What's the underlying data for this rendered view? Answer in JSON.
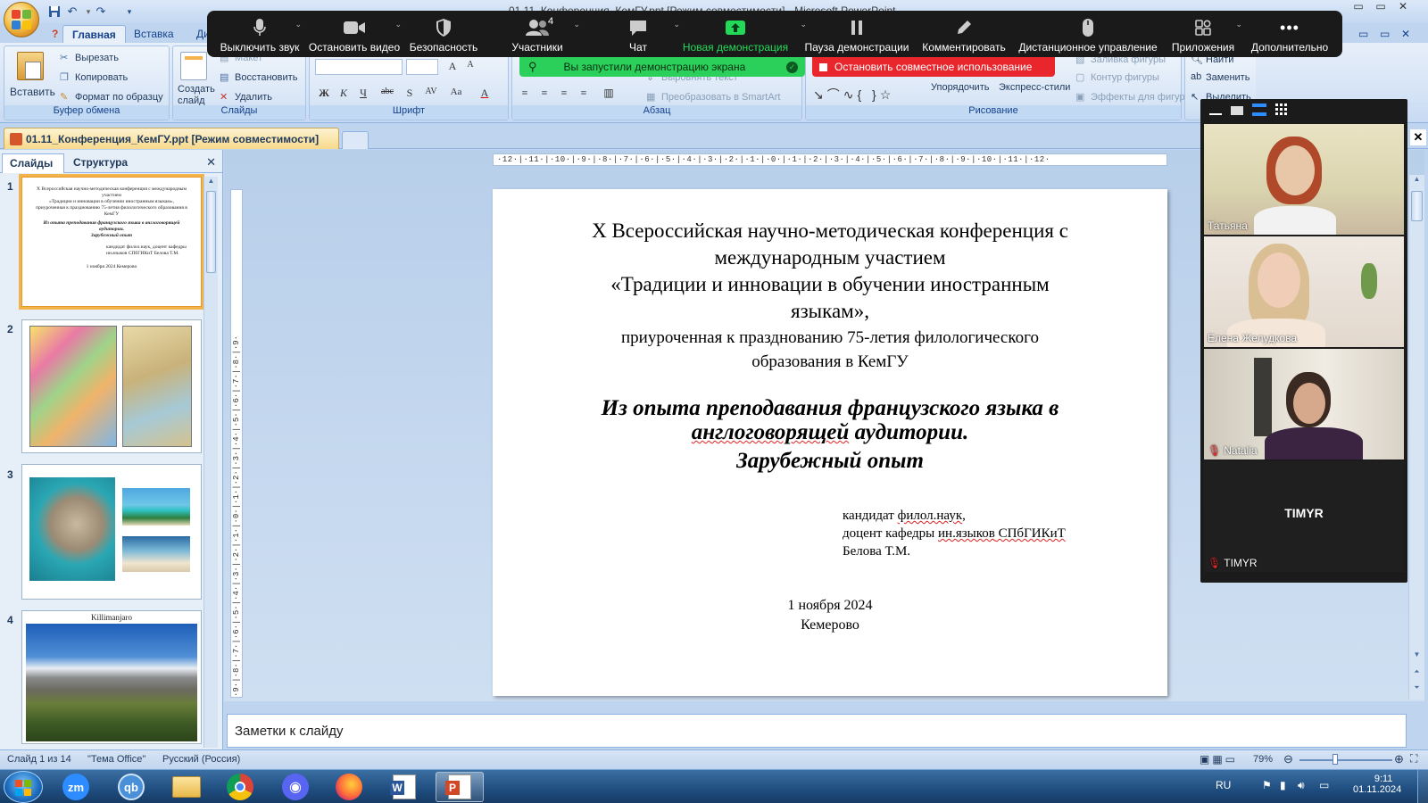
{
  "window": {
    "title": "01.11_Конференция_КемГУ.ppt [Режим совместимости] - Microsoft PowerPoint",
    "minimize": "▭",
    "restore": "▭",
    "close": "✕"
  },
  "ribbon_tabs": [
    "Главная",
    "Вставка",
    "Дизайн"
  ],
  "clipboard": {
    "paste": "Вставить",
    "cut": "Вырезать",
    "copy": "Копировать",
    "format_painter": "Формат по образцу",
    "label": "Буфер обмена"
  },
  "slides_group": {
    "new_slide": "Создать слайд",
    "layout": "Макет",
    "reset": "Восстановить",
    "delete": "Удалить",
    "label": "Слайды"
  },
  "font_group": {
    "label": "Шрифт",
    "bold": "Ж",
    "italic": "К",
    "underline": "Ч",
    "strike": "abc",
    "shadow": "S",
    "spacing": "AV",
    "case": "Aa",
    "color": "A"
  },
  "paragraph_group": {
    "label": "Абзац",
    "align_text": "Выровнять текст",
    "smartart": "Преобразовать в SmartArt"
  },
  "drawing_group": {
    "label": "Рисование",
    "arrange": "Упорядочить",
    "quick_styles": "Экспресс-стили",
    "shape_fill": "Заливка фигуры",
    "shape_outline": "Контур фигуры",
    "shape_effects": "Эффекты для фигур"
  },
  "editing_group": {
    "find": "Найти",
    "replace": "Заменить",
    "select": "Выделить"
  },
  "zoom_toolbar": {
    "items": [
      {
        "label": "Выключить звук"
      },
      {
        "label": "Остановить видео"
      },
      {
        "label": "Безопасность"
      },
      {
        "label": "Участники",
        "count": "4"
      },
      {
        "label": "Чат"
      },
      {
        "label": "Новая демонстрация"
      },
      {
        "label": "Пауза демонстрации"
      },
      {
        "label": "Комментировать"
      },
      {
        "label": "Дистанционное управление"
      },
      {
        "label": "Приложения"
      },
      {
        "label": "Дополнительно"
      }
    ],
    "share_banner": "Вы запустили демонстрацию экрана",
    "stop_share": "Остановить совместное использование",
    "accent_green": "#23d959",
    "accent_red": "#e8262c"
  },
  "doc_tab": "01.11_Конференция_КемГУ.ppt [Режим совместимости]",
  "pane_tabs": [
    "Слайды",
    "Структура"
  ],
  "thumbnails": {
    "slide1_lines": [
      "X Всероссийская научно-методическая конференция с международным участием",
      "«Традиции и инновации в обучении иностранным языкам»,",
      "приуроченная к празднованию 75-летия филологического образования в КемГУ",
      "Из опыта преподавания французского языка в англоговорящей аудитории.",
      "Зарубежный опыт",
      "кандидат филол.наук, доцент кафедры ин.языков СПбГИКиТ Белова Т.М.",
      "1 ноября 2024 Кемерово"
    ],
    "slide4_caption": "Killimanjaro",
    "numbers": [
      "1",
      "2",
      "3",
      "4"
    ]
  },
  "ruler": {
    "horizontal": "·12·|·11·|·10·|·9·|·8·|·7·|·6·|·5·|·4·|·3·|·2·|·1·|·0·|·1·|·2·|·3·|·4·|·5·|·6·|·7·|·8·|·9·|·10·|·11·|·12·",
    "vertical": "·9·|·8·|·7·|·6·|·5·|·4·|·3·|·2·|·1·|·0·|·1·|·2·|·3·|·4·|·5·|·6·|·7·|·8·|·9·"
  },
  "slide": {
    "line1": "X Всероссийская  научно-методическая  конференция с",
    "line2": "международным участием",
    "line3": "«Традиции и инновации в обучении иностранным",
    "line4": "языкам»,",
    "line5": "приуроченная к празднованию 75-летия филологического",
    "line6": "образования в КемГУ",
    "topic1": "Из опыта преподавания французского языка в",
    "topic2_under": "англоговорящей",
    "topic2_rest": " аудитории.",
    "topic3": "Зарубежный опыт",
    "author1_a": "кандидат ",
    "author1_b": "филол.наук",
    "author1_c": ",",
    "author2_a": "доцент кафедры  ",
    "author2_b": "ин.языков",
    "author2_c": " СПбГИКиТ",
    "author3": "Белова Т.М.",
    "date": "1 ноября 2024",
    "city": "Кемерово"
  },
  "notes_placeholder": "Заметки к слайду",
  "participants": [
    {
      "name": "Татьяна",
      "muted": false
    },
    {
      "name": "Елена Желудкова",
      "muted": false
    },
    {
      "name": "Natalia",
      "muted": true
    },
    {
      "name": "TIMYR",
      "muted": true,
      "big_label": "TIMYR"
    }
  ],
  "statusbar": {
    "slide_info": "Слайд 1 из 14",
    "theme": "\"Тема Office\"",
    "language": "Русский (Россия)",
    "zoom": "79%",
    "zoom_level": 0.79
  },
  "taskbar": {
    "apps": [
      "zoom-app",
      "qbittorrent-app",
      "explorer-app",
      "chrome-app",
      "discord-app",
      "firefox-app",
      "word-app",
      "powerpoint-app"
    ],
    "zoom_label": "zm",
    "qb_label": "qb",
    "lang": "RU",
    "time": "9:11",
    "date": "01.11.2024"
  }
}
